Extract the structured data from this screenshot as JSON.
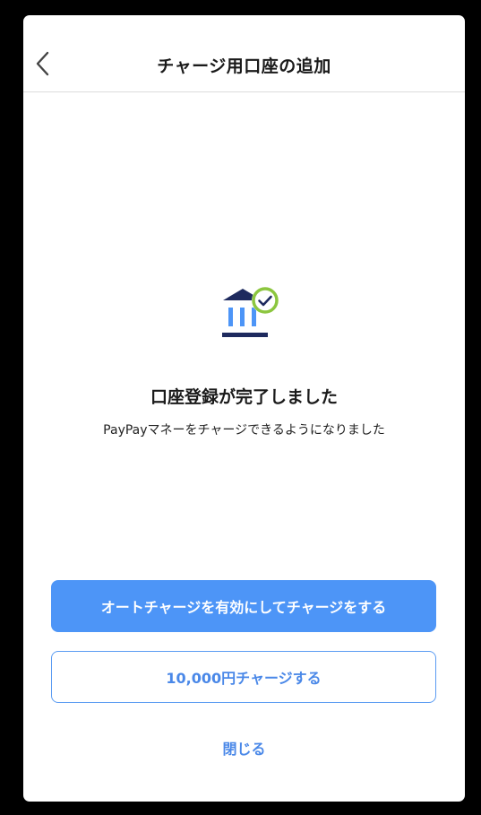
{
  "header": {
    "title": "チャージ用口座の追加",
    "back_icon": "chevron-left-icon"
  },
  "result": {
    "icon": "bank-check-icon",
    "title": "口座登録が完了しました",
    "subtitle": "PayPayマネーをチャージできるようになりました"
  },
  "actions": {
    "primary_label": "オートチャージを有効にしてチャージをする",
    "secondary_label": "10,000円チャージする",
    "close_label": "閉じる"
  },
  "colors": {
    "accent": "#4d95f7",
    "bank_navy": "#1e2a5e",
    "bank_blue": "#4d95f7",
    "check_green": "#8cc63f"
  }
}
